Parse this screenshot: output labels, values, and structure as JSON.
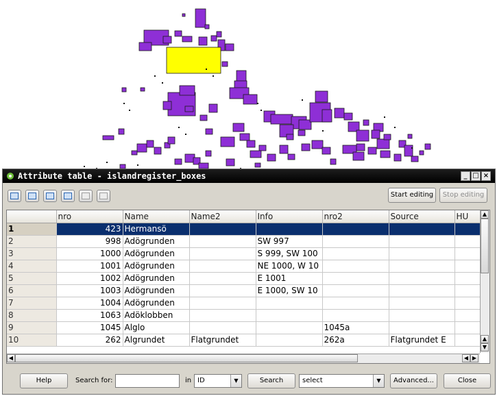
{
  "map": {
    "fill_color": "#8e2fd6",
    "selected_color": "#ffff00",
    "stroke_color": "#1a1a1a"
  },
  "window": {
    "title": "Attribute table - islandregister_boxes",
    "icon": "qgis-icon",
    "controls": [
      "minimize-icon",
      "maximize-icon",
      "close-icon"
    ],
    "selection_color": "#0a2f6e"
  },
  "toolbar": {
    "tools": [
      "remove-selection-icon",
      "move-selection-to-top-icon",
      "invert-selection-icon",
      "copy-selected-rows-icon",
      "zoom-to-selection-icon",
      "delete-selected-icon"
    ],
    "start_editing": "Start editing",
    "stop_editing": "Stop editing"
  },
  "table": {
    "columns": [
      "nro",
      "Name",
      "Name2",
      "Info",
      "nro2",
      "Source",
      "HU"
    ],
    "rows": [
      {
        "id": "1",
        "nro": "423",
        "Name": "Hermansö",
        "Name2": "",
        "Info": "",
        "nro2": "",
        "Source": "",
        "HU": ""
      },
      {
        "id": "2",
        "nro": "998",
        "Name": "Adögrunden",
        "Name2": "",
        "Info": "SW 997",
        "nro2": "",
        "Source": "",
        "HU": ""
      },
      {
        "id": "3",
        "nro": "1000",
        "Name": "Adögrunden",
        "Name2": "",
        "Info": "S 999, SW 100",
        "nro2": "",
        "Source": "",
        "HU": ""
      },
      {
        "id": "4",
        "nro": "1001",
        "Name": "Adögrunden",
        "Name2": "",
        "Info": "NE 1000, W 10",
        "nro2": "",
        "Source": "",
        "HU": ""
      },
      {
        "id": "5",
        "nro": "1002",
        "Name": "Adögrunden",
        "Name2": "",
        "Info": "E 1001",
        "nro2": "",
        "Source": "",
        "HU": ""
      },
      {
        "id": "6",
        "nro": "1003",
        "Name": "Adögrunden",
        "Name2": "",
        "Info": "E 1000, SW 10",
        "nro2": "",
        "Source": "",
        "HU": ""
      },
      {
        "id": "7",
        "nro": "1004",
        "Name": "Adögrunden",
        "Name2": "",
        "Info": "",
        "nro2": "",
        "Source": "",
        "HU": ""
      },
      {
        "id": "8",
        "nro": "1063",
        "Name": "Adöklobben",
        "Name2": "",
        "Info": "",
        "nro2": "",
        "Source": "",
        "HU": ""
      },
      {
        "id": "9",
        "nro": "1045",
        "Name": "Alglo",
        "Name2": "",
        "Info": "",
        "nro2": "1045a",
        "Source": "",
        "HU": ""
      },
      {
        "id": "10",
        "nro": "262",
        "Name": "Algrundet",
        "Name2": "Flatgrundet",
        "Info": "",
        "nro2": "262a",
        "Source": "Flatgrundet E",
        "HU": ""
      }
    ]
  },
  "bottom": {
    "help": "Help",
    "search_for_label": "Search for:",
    "search_value": "",
    "in_label": "in",
    "field_select": "ID",
    "search_button": "Search",
    "action_select": "select",
    "advanced": "Advanced...",
    "close": "Close"
  }
}
